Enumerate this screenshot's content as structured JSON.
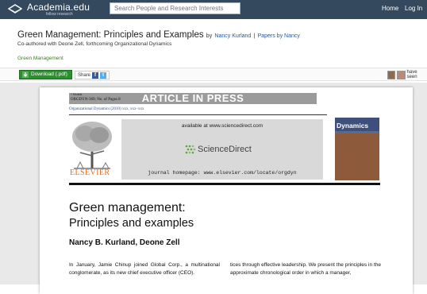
{
  "topbar": {
    "logo_text": "Academia.edu",
    "logo_sub": "follow research",
    "search_placeholder": "Search People and Research Interests",
    "nav": [
      {
        "label": "Home"
      },
      {
        "label": "Log In"
      }
    ]
  },
  "paper": {
    "title": "Green Management: Principles and Examples",
    "by": "by",
    "author_link": "Nancy Kurland",
    "papers_link": "Papers by Nancy",
    "separator": "|",
    "coauthor_line": "Co-authored with Deone Zell, forthcoming Organizational Dynamics",
    "tag": "Green Management"
  },
  "toolbar": {
    "download_label": "Download (.pdf)",
    "share_label": "Share",
    "fb_glyph": "f",
    "tw_glyph": "t",
    "have_seen": "have seen"
  },
  "document": {
    "article_in_press": "ARTICLE IN PRESS",
    "models_tag": "+ Models",
    "ref_line": "ORGDYN-369; No. of Pages 8",
    "journal_line": "Organizational Dynamics (2010) xxx, xxx–xxx",
    "available_at": "available at www.sciencedirect.com",
    "sciencedirect": "ScienceDirect",
    "journal_homepage": "journal homepage: www.elsevier.com/locate/orgdyn",
    "publisher": "ELSEVIER",
    "cover_title": "Dynamics",
    "title": "Green management:",
    "subtitle": "Principles and examples",
    "authors": "Nancy B. Kurland, Deone Zell",
    "col_left": "In January, Jamie Chinup joined Global Corp., a multinational conglomerate, as its new chief executive officer (CEO).",
    "col_right": "tices through effective leadership. We present the principles in the approximate chronological order in which a manager,"
  },
  "colors": {
    "topbar": "#34495e",
    "download": "#2c8f2e",
    "link": "#1f5aa8",
    "elsevier": "#e86a1a"
  },
  "icons": [
    "academia-logo-icon",
    "download-icon",
    "facebook-icon",
    "twitter-icon",
    "sciencedirect-logo-icon",
    "elsevier-tree-icon"
  ]
}
